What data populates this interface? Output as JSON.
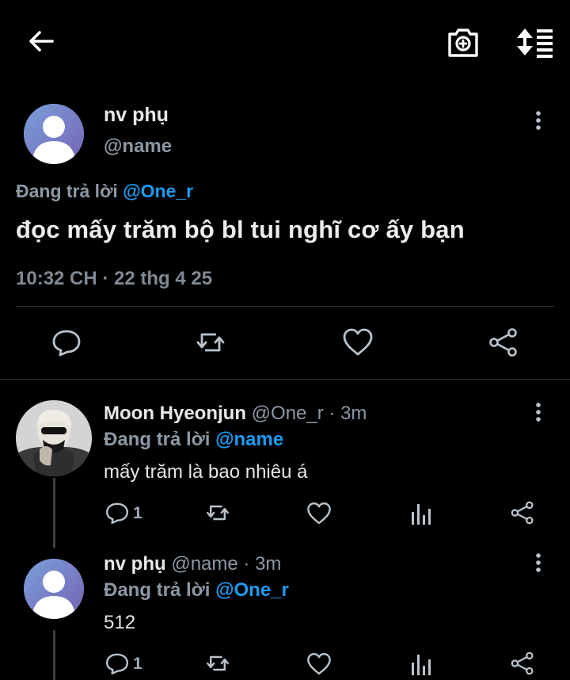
{
  "topbar": {
    "back_icon": "arrow-left-icon",
    "camera_icon": "camera-add-icon",
    "sort_icon": "sort-list-icon"
  },
  "main_tweet": {
    "author_name": "nv phụ",
    "author_handle": "@name",
    "replying_prefix": "Đang trả lời",
    "replying_to": "@One_r",
    "text": "đọc mấy trăm bộ bl tui nghĩ cơ ấy bạn",
    "timestamp": "10:32 CH · 22 thg 4 25"
  },
  "replies": [
    {
      "author_name": "Moon Hyeonjun",
      "author_handle": "@One_r",
      "time_ago": "· 3m",
      "replying_prefix": "Đang trả lời",
      "replying_to": "@name",
      "text": "mấy trăm là bao nhiêu á",
      "reply_count": "1"
    },
    {
      "author_name": "nv phụ",
      "author_handle": "@name",
      "time_ago": "· 3m",
      "replying_prefix": "Đang trả lời",
      "replying_to": "@One_r",
      "text": "512",
      "reply_count": "1"
    }
  ],
  "colors": {
    "background": "#000000",
    "accent": "#1d9bf0",
    "secondary_text": "#8b98a5",
    "icon": "#b9c3cc"
  }
}
